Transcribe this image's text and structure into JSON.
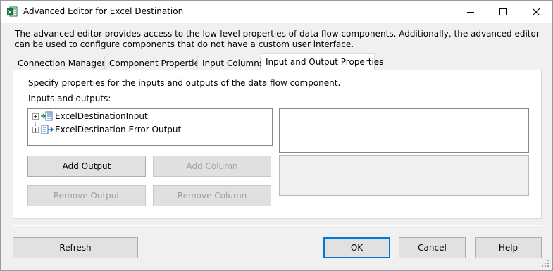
{
  "window": {
    "title": "Advanced Editor for Excel Destination",
    "icon": "excel-icon"
  },
  "intro": "The advanced editor provides access to the low-level properties of data flow components. Additionally, the advanced editor can be used to configure components that do not have a custom user interface.",
  "tabs": [
    {
      "label": "Connection Managers",
      "active": false
    },
    {
      "label": "Component Properties",
      "active": false
    },
    {
      "label": "Input Columns",
      "active": false
    },
    {
      "label": "Input and Output Properties",
      "active": true
    }
  ],
  "panel": {
    "instructions": "Specify properties for the inputs and outputs of the data flow component.",
    "tree_label": "Inputs and outputs:",
    "tree_items": [
      {
        "label": "ExcelDestinationInput",
        "icon": "input-icon"
      },
      {
        "label": "ExcelDestination Error Output",
        "icon": "error-output-icon"
      }
    ],
    "buttons": {
      "add_output": "Add Output",
      "add_column": "Add Column",
      "remove_output": "Remove Output",
      "remove_column": "Remove Column"
    }
  },
  "footer": {
    "refresh": "Refresh",
    "ok": "OK",
    "cancel": "Cancel",
    "help": "Help"
  },
  "colors": {
    "accent": "#0078d7",
    "window_bg": "#f0f0f0",
    "excel_green": "#1d6f42"
  }
}
